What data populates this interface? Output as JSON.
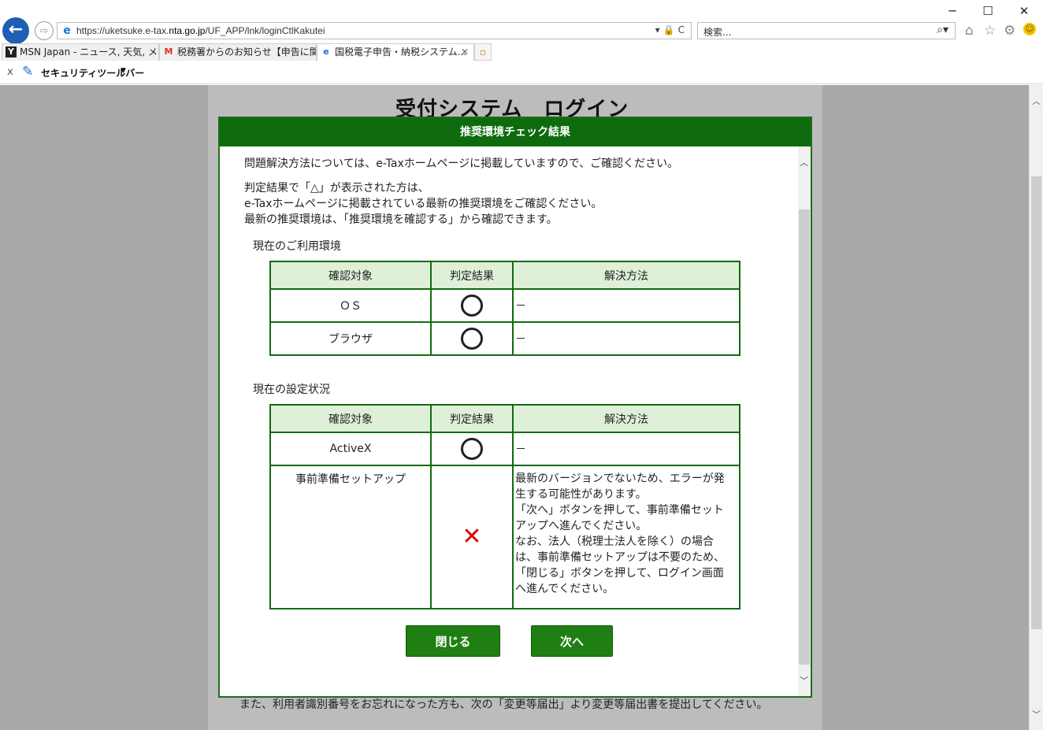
{
  "window": {
    "minimize": "─",
    "maximize": "☐",
    "close": "✕"
  },
  "nav": {
    "back_glyph": "←",
    "forward_glyph": "⇨"
  },
  "address": {
    "url_prefix": "https://uketsuke.e-tax.",
    "url_host": "nta.go.jp",
    "url_path": "/UF_APP/lnk/loginCtlKakutei",
    "tools": "▾🔒C"
  },
  "search": {
    "placeholder": "検索...",
    "icon": "⌕▾"
  },
  "toolbar_icons": {
    "home": "⌂",
    "favorites": "☆",
    "settings": "⚙",
    "smiley": "☺"
  },
  "tabs": [
    {
      "label": "MSN Japan - ニュース, 天気, メー...",
      "icon": "Y",
      "active": false
    },
    {
      "label": "税務署からのお知らせ【申告に関...",
      "icon": "M",
      "active": false
    },
    {
      "label": "国税電子申告・納税システム...",
      "icon": "e",
      "active": true,
      "close": "✕"
    }
  ],
  "newtab_icon": "▫",
  "security_toolbar": {
    "close": "x",
    "pen_icon": "✎",
    "label": "セキュリティツールバー",
    "dropdown": "▼"
  },
  "background_page": {
    "title": "受付システム　ログイン",
    "text": "また、利用者識別番号をお忘れになった方も、次の「変更等届出」より変更等届出書を提出してください。"
  },
  "dialog": {
    "header": "推奨環境チェック結果",
    "intro": "問題解決方法については、e-Taxホームページに掲載していますので、ご確認ください。",
    "notice_lines": [
      "判定結果で「△」が表示された方は、",
      "e-Taxホームページに掲載されている最新の推奨環境をご確認ください。",
      "最新の推奨環境は、「推奨環境を確認する」から確認できます。"
    ],
    "section1_title": "現在のご利用環境",
    "section2_title": "現在の設定状況",
    "columns": {
      "target": "確認対象",
      "result": "判定結果",
      "solution": "解決方法"
    },
    "env_rows": [
      {
        "target": "ＯＳ",
        "result": "ok",
        "solution": "－"
      },
      {
        "target": "ブラウザ",
        "result": "ok",
        "solution": "－"
      }
    ],
    "setting_rows": [
      {
        "target": "ActiveX",
        "result": "ok",
        "solution": "－"
      },
      {
        "target": "事前準備セットアップ",
        "result": "ng",
        "solution_lines": [
          "最新のバージョンでないため、エラーが発",
          "生する可能性があります。",
          "「次へ」ボタンを押して、事前準備セット",
          "アップへ進んでください。",
          "なお、法人（税理士法人を除く）の場合",
          "は、事前準備セットアップは不要のため、",
          "「閉じる」ボタンを押して、ログイン画面",
          "へ進んでください。"
        ]
      }
    ],
    "cross_glyph": "✕",
    "close_button": "閉じる",
    "next_button": "次へ"
  },
  "scroll_glyphs": {
    "up": "︿",
    "down": "﹀"
  }
}
